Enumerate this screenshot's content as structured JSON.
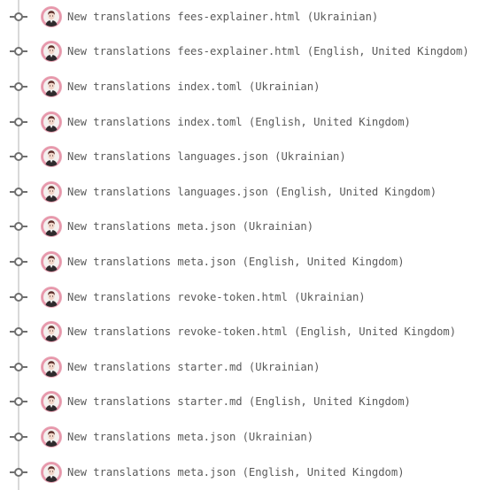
{
  "timeline": {
    "colors": {
      "line": "#d9d9d9",
      "node": "#707070",
      "avatar_ring": "#e796aa",
      "text": "#5a5a5a"
    },
    "commits": [
      {
        "message": "New translations fees-explainer.html (Ukrainian)",
        "icon": "commit-node-icon",
        "avatar": "user-avatar"
      },
      {
        "message": "New translations fees-explainer.html (English, United Kingdom)",
        "icon": "commit-node-icon",
        "avatar": "user-avatar"
      },
      {
        "message": "New translations index.toml (Ukrainian)",
        "icon": "commit-node-icon",
        "avatar": "user-avatar"
      },
      {
        "message": "New translations index.toml (English, United Kingdom)",
        "icon": "commit-node-icon",
        "avatar": "user-avatar"
      },
      {
        "message": "New translations languages.json (Ukrainian)",
        "icon": "commit-node-icon",
        "avatar": "user-avatar"
      },
      {
        "message": "New translations languages.json (English, United Kingdom)",
        "icon": "commit-node-icon",
        "avatar": "user-avatar"
      },
      {
        "message": "New translations meta.json (Ukrainian)",
        "icon": "commit-node-icon",
        "avatar": "user-avatar"
      },
      {
        "message": "New translations meta.json (English, United Kingdom)",
        "icon": "commit-node-icon",
        "avatar": "user-avatar"
      },
      {
        "message": "New translations revoke-token.html (Ukrainian)",
        "icon": "commit-node-icon",
        "avatar": "user-avatar"
      },
      {
        "message": "New translations revoke-token.html (English, United Kingdom)",
        "icon": "commit-node-icon",
        "avatar": "user-avatar"
      },
      {
        "message": "New translations starter.md (Ukrainian)",
        "icon": "commit-node-icon",
        "avatar": "user-avatar"
      },
      {
        "message": "New translations starter.md (English, United Kingdom)",
        "icon": "commit-node-icon",
        "avatar": "user-avatar"
      },
      {
        "message": "New translations meta.json (Ukrainian)",
        "icon": "commit-node-icon",
        "avatar": "user-avatar"
      },
      {
        "message": "New translations meta.json (English, United Kingdom)",
        "icon": "commit-node-icon",
        "avatar": "user-avatar"
      }
    ]
  }
}
